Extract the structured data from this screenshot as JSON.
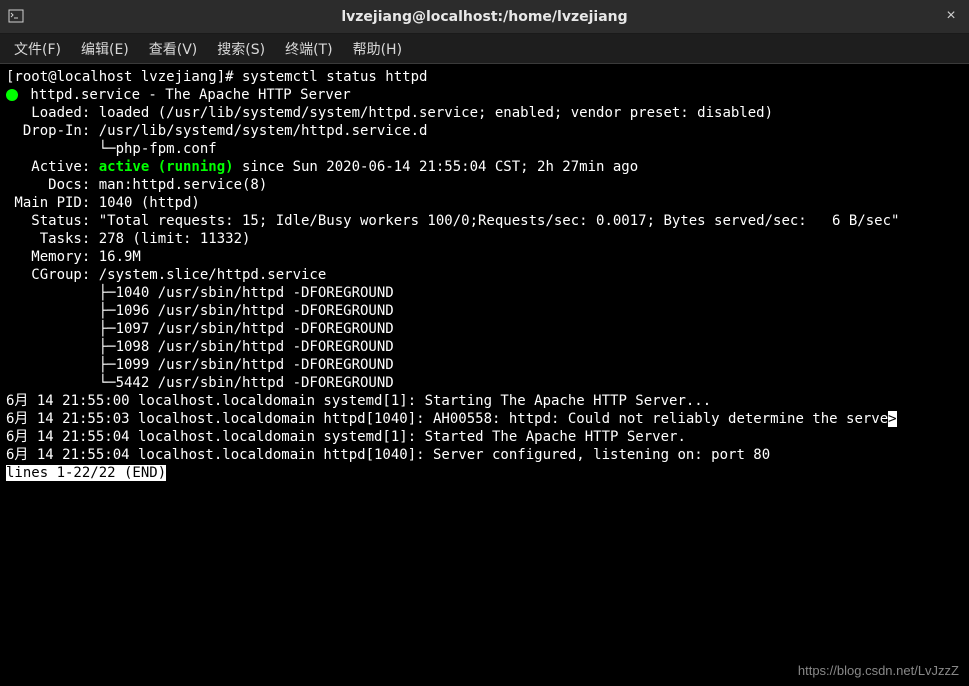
{
  "titlebar": {
    "title": "lvzejiang@localhost:/home/lvzejiang"
  },
  "menu": {
    "file": "文件(F)",
    "edit": "编辑(E)",
    "view": "查看(V)",
    "search": "搜索(S)",
    "terminal": "终端(T)",
    "help": "帮助(H)"
  },
  "terminal": {
    "prompt": "[root@localhost lvzejiang]# systemctl status httpd",
    "service_line": " httpd.service - The Apache HTTP Server",
    "loaded": "   Loaded: loaded (/usr/lib/systemd/system/httpd.service; enabled; vendor preset: disabled)",
    "dropin1": "  Drop-In: /usr/lib/systemd/system/httpd.service.d",
    "dropin2": "           └─php-fpm.conf",
    "active_prefix": "   Active: ",
    "active_status": "active (running)",
    "active_suffix": " since Sun 2020-06-14 21:55:04 CST; 2h 27min ago",
    "docs": "     Docs: man:httpd.service(8)",
    "mainpid": " Main PID: 1040 (httpd)",
    "status": "   Status: \"Total requests: 15; Idle/Busy workers 100/0;Requests/sec: 0.0017; Bytes served/sec:   6 B/sec\"",
    "tasks": "    Tasks: 278 (limit: 11332)",
    "memory": "   Memory: 16.9M",
    "cgroup": "   CGroup: /system.slice/httpd.service",
    "proc1": "           ├─1040 /usr/sbin/httpd -DFOREGROUND",
    "proc2": "           ├─1096 /usr/sbin/httpd -DFOREGROUND",
    "proc3": "           ├─1097 /usr/sbin/httpd -DFOREGROUND",
    "proc4": "           ├─1098 /usr/sbin/httpd -DFOREGROUND",
    "proc5": "           ├─1099 /usr/sbin/httpd -DFOREGROUND",
    "proc6": "           └─5442 /usr/sbin/httpd -DFOREGROUND",
    "blank": "",
    "log1": "6月 14 21:55:00 localhost.localdomain systemd[1]: Starting The Apache HTTP Server...",
    "log2a": "6月 14 21:55:03 localhost.localdomain httpd[1040]: AH00558: httpd: Could not reliably determine the serve",
    "log2b": ">",
    "log3": "6月 14 21:55:04 localhost.localdomain systemd[1]: Started The Apache HTTP Server.",
    "log4": "6月 14 21:55:04 localhost.localdomain httpd[1040]: Server configured, listening on: port 80",
    "pager": "lines 1-22/22 (END)"
  },
  "watermark": "https://blog.csdn.net/LvJzzZ"
}
